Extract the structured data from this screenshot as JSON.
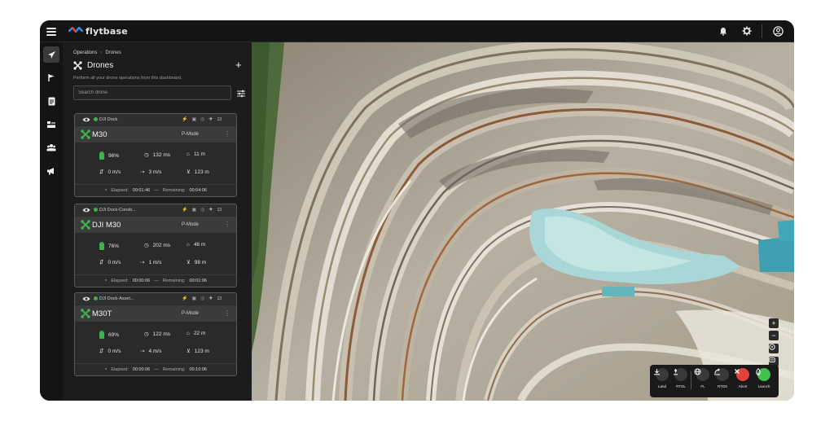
{
  "colors": {
    "accent_green": "#3fb24d",
    "brand_blue": "#3a8ee6",
    "danger": "#e0433a",
    "launch": "#41c04f"
  },
  "header": {
    "logo_text": "flytbase",
    "icons": [
      "menu-icon",
      "bell-icon",
      "gear-icon",
      "user-circle-icon"
    ]
  },
  "sidenav": {
    "items": [
      {
        "icon": "plane-icon",
        "active": true
      },
      {
        "icon": "flag-icon",
        "active": false
      },
      {
        "icon": "report-icon",
        "active": false
      },
      {
        "icon": "dock-icon",
        "active": false
      },
      {
        "icon": "team-icon",
        "active": false
      },
      {
        "icon": "megaphone-icon",
        "active": false
      }
    ]
  },
  "panel": {
    "breadcrumb": [
      "Operations",
      "Drones"
    ],
    "title": "Drones",
    "subtitle": "Perform all your drone operations from this dashboard.",
    "search_placeholder": "Search drone"
  },
  "drones": [
    {
      "dock": "DJI Dock",
      "name": "M30",
      "mode": "P-Mode",
      "signal_count": "13",
      "battery": "96%",
      "latency": "132 ms",
      "altitude": "11 m",
      "vertical_speed": "0 m/s",
      "horizontal_speed": "3 m/s",
      "distance": "123 m",
      "elapsed_label": "Elapsed:",
      "elapsed": "00:01:46",
      "remaining_label": "Remaining:",
      "remaining": "00:04:06"
    },
    {
      "dock": "DJI Dock-Constr...",
      "name": "DJI M30",
      "mode": "P-Mode",
      "signal_count": "13",
      "battery": "76%",
      "latency": "202 ms",
      "altitude": "46 m",
      "vertical_speed": "0 m/s",
      "horizontal_speed": "1 m/s",
      "distance": "98 m",
      "elapsed_label": "Elapsed:",
      "elapsed": "00:00:06",
      "remaining_label": "Remaining:",
      "remaining": "00:01:06"
    },
    {
      "dock": "DJI Dock-Asset...",
      "name": "M30T",
      "mode": "P-Mode",
      "signal_count": "13",
      "battery": "69%",
      "latency": "122 ms",
      "altitude": "22 m",
      "vertical_speed": "0 m/s",
      "horizontal_speed": "4 m/s",
      "distance": "123 m",
      "elapsed_label": "Elapsed:",
      "elapsed": "00:00:06",
      "remaining_label": "Remaining:",
      "remaining": "00:10:06"
    }
  ],
  "map": {
    "zoom_in": "+",
    "zoom_out": "−",
    "actions": [
      {
        "label": "Land",
        "icon": "land-icon"
      },
      {
        "label": "RTDL",
        "icon": "rtdl-icon"
      },
      {
        "label": "FL",
        "icon": "globe-icon"
      },
      {
        "label": "RTDS",
        "icon": "rtds-icon"
      },
      {
        "label": "Abort",
        "icon": "close-icon"
      },
      {
        "label": "Launch",
        "icon": "launch-icon"
      }
    ]
  }
}
